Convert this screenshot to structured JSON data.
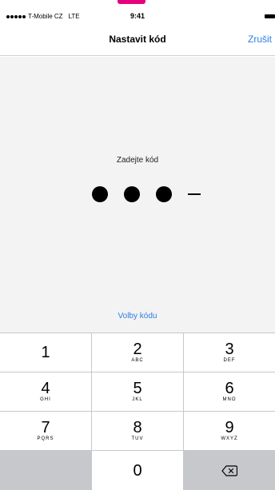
{
  "status_bar": {
    "carrier": "T-Mobile CZ",
    "network": "LTE",
    "time": "9:41"
  },
  "nav": {
    "title": "Nastavit kód",
    "cancel_label": "Zrušit"
  },
  "passcode": {
    "prompt": "Zadejte kód",
    "entered_digits": 3,
    "total_digits": 4
  },
  "options_link": "Volby kódu",
  "keypad": {
    "keys": [
      {
        "number": "1",
        "letters": ""
      },
      {
        "number": "2",
        "letters": "ABC"
      },
      {
        "number": "3",
        "letters": "DEF"
      },
      {
        "number": "4",
        "letters": "GHI"
      },
      {
        "number": "5",
        "letters": "JKL"
      },
      {
        "number": "6",
        "letters": "MNO"
      },
      {
        "number": "7",
        "letters": "PQRS"
      },
      {
        "number": "8",
        "letters": "TUV"
      },
      {
        "number": "9",
        "letters": "WXYZ"
      },
      {
        "number": "0",
        "letters": ""
      }
    ],
    "delete_icon": "delete-backspace-icon"
  },
  "colors": {
    "accent": "#2d7fe0",
    "brand": "#e6007e",
    "keypad_background": "#c7c8cc",
    "content_background": "#f3f3f3"
  }
}
